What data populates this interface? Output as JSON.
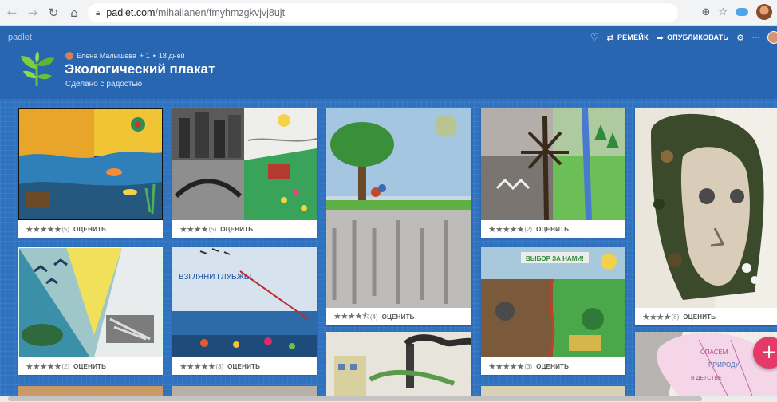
{
  "browser": {
    "url_host": "padlet.com",
    "url_path": "/mihailanen/fmyhmzgkvjvj8ujt",
    "icons": [
      "back-icon",
      "forward-icon",
      "reload-icon",
      "home-icon",
      "lock-icon",
      "zoom-icon",
      "star-icon",
      "extension-icon",
      "profile-avatar"
    ]
  },
  "padlet": {
    "brand": "padlet",
    "toolbar": {
      "remake": "РЕМЕЙК",
      "publish": "ОПУБЛИКОВАТЬ",
      "more": "···"
    },
    "author": "Елена Малышева",
    "plus": "+ 1",
    "separator": "•",
    "age": "18 дней",
    "title": "Экологический плакат",
    "subtitle": "Сделано с радостью",
    "rate_label": "ОЦЕНИТЬ",
    "posts": [
      {
        "stars": "★★★★★",
        "count": "(5)"
      },
      {
        "stars": "★★★★",
        "count": "(5)"
      },
      {
        "stars": "★★★★⯪",
        "count": "(4)"
      },
      {
        "stars": "★★★★★",
        "count": "(2)"
      },
      {
        "stars": "★★★★",
        "count": "(8)"
      },
      {
        "stars": "★★★★★",
        "count": "(2)"
      },
      {
        "stars": "★★★★★",
        "count": "(3)"
      },
      {
        "stars": "★★★★★",
        "count": "(3)"
      }
    ],
    "image_text": {
      "post_6": "ВЗГЛЯНИ ГЛУБЖЕ!",
      "post_8": "ВЫБОР ЗА НАМИ!",
      "post_12_a": "СПАСЕМ",
      "post_12_b": "ПРИРОДУ",
      "post_12_c": "В ДЕТСТВЕ"
    },
    "colors": {
      "board": "#2f72c0",
      "header": "#2866b2",
      "fab": "#e5396a",
      "card": "#ffffff"
    }
  }
}
